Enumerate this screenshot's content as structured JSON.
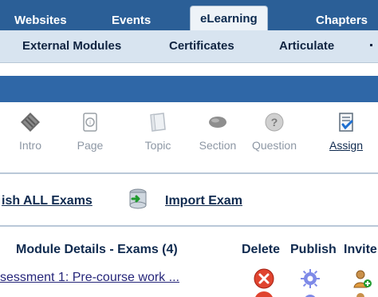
{
  "tabs": [
    {
      "label": "Websites"
    },
    {
      "label": "Events"
    },
    {
      "label": "eLearning"
    },
    {
      "label": "Chapters"
    }
  ],
  "subnav": [
    {
      "label": "External Modules"
    },
    {
      "label": "Certificates"
    },
    {
      "label": "Articulate"
    }
  ],
  "toolbar": {
    "items": [
      {
        "label": "Intro",
        "icon": "book-icon"
      },
      {
        "label": "Page",
        "icon": "page-icon"
      },
      {
        "label": "Topic",
        "icon": "folder-icon"
      },
      {
        "label": "Section",
        "icon": "oval-icon"
      },
      {
        "label": "Question",
        "icon": "question-icon"
      },
      {
        "label": "Assign",
        "icon": "assign-icon"
      }
    ]
  },
  "actions": {
    "publish_all": "ish ALL Exams",
    "import_exam": "Import Exam"
  },
  "table": {
    "header_title": "Module Details - Exams (4)",
    "col_delete": "Delete",
    "col_publish": "Publish",
    "col_invite": "Invite",
    "row1_link": "sessment 1: Pre-course work ..."
  }
}
